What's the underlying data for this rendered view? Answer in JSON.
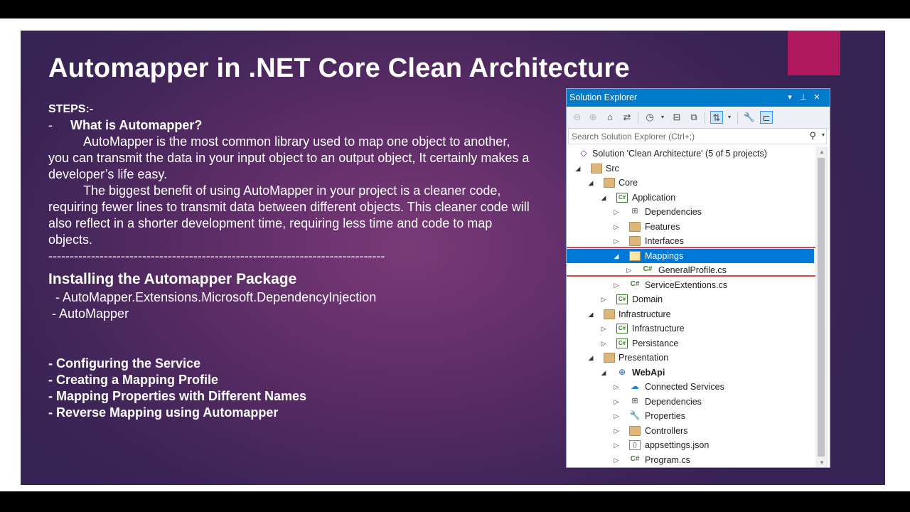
{
  "slide": {
    "title": "Automapper in .NET Core Clean Architecture",
    "steps_label": "STEPS:-",
    "bullet_dash": "-",
    "q_heading": "What is Automapper?",
    "para1": "AutoMapper is the most common library used to map one object to another, you can transmit the data in your input object to an output object, It certainly makes a developer’s life easy.",
    "para2": "The biggest benefit of using  AutoMapper in your project is a cleaner code, requiring fewer lines to transmit data between different objects. This cleaner code will also reflect in a shorter development time, requiring less time and code to map objects.",
    "divider": "-------------------------------------------------------------------------------",
    "install_heading": "Installing the Automapper Package",
    "packages": [
      "  - AutoMapper.Extensions.Microsoft.DependencyInjection",
      " - AutoMapper"
    ],
    "topics": [
      "- Configuring the Service",
      "- Creating a Mapping Profile",
      "- Mapping Properties with Different Names",
      "- Reverse Mapping using Automapper"
    ],
    "colors": {
      "accent": "#b0195e",
      "background": "#5b2c66",
      "text": "#ffffff"
    }
  },
  "solution_explorer": {
    "title": "Solution Explorer",
    "window_buttons": {
      "dropdown": "▾",
      "pin": "⊥",
      "close": "✕"
    },
    "toolbar_icons": [
      "back-icon",
      "forward-icon",
      "home-icon",
      "switch-views-icon",
      "history-icon",
      "collapse-all-icon",
      "show-all-files-icon",
      "sync-icon",
      "properties-wrench-icon",
      "preview-icon"
    ],
    "search_placeholder": "Search Solution Explorer (Ctrl+;)",
    "search_icon": "⚲",
    "search_dropdown": "▾",
    "tree": [
      {
        "label": "Solution 'Clean Architecture' (5 of 5 projects)",
        "icon": "sln",
        "glyph": "◇",
        "arrow": ""
      },
      {
        "label": "Src",
        "icon": "folder",
        "glyph": "",
        "arrow": "◢"
      },
      {
        "label": "Core",
        "icon": "folder",
        "glyph": "",
        "arrow": "◢"
      },
      {
        "label": "Application",
        "icon": "csproj",
        "glyph": "C#",
        "arrow": "◢"
      },
      {
        "label": "Dependencies",
        "icon": "dep",
        "glyph": "⊞",
        "arrow": "▷"
      },
      {
        "label": "Features",
        "icon": "folder",
        "glyph": "",
        "arrow": "▷"
      },
      {
        "label": "Interfaces",
        "icon": "folder",
        "glyph": "",
        "arrow": "▷"
      },
      {
        "label": "Mappings",
        "icon": "folder-open",
        "glyph": "",
        "arrow": "◢",
        "selected": true
      },
      {
        "label": "GeneralProfile.cs",
        "icon": "csfile",
        "glyph": "C#",
        "arrow": "▷"
      },
      {
        "label": "ServiceExtentions.cs",
        "icon": "csfile",
        "glyph": "C#",
        "arrow": "▷"
      },
      {
        "label": "Domain",
        "icon": "csproj",
        "glyph": "C#",
        "arrow": "▷"
      },
      {
        "label": "Infrastructure",
        "icon": "folder",
        "glyph": "",
        "arrow": "◢"
      },
      {
        "label": "Infrastructure",
        "icon": "csproj",
        "glyph": "C#",
        "arrow": "▷"
      },
      {
        "label": "Persistance",
        "icon": "csproj",
        "glyph": "C#",
        "arrow": "▷"
      },
      {
        "label": "Presentation",
        "icon": "folder",
        "glyph": "",
        "arrow": "◢"
      },
      {
        "label": "WebApi",
        "icon": "web",
        "glyph": "⊕",
        "arrow": "◢",
        "bold": true
      },
      {
        "label": "Connected Services",
        "icon": "conn",
        "glyph": "☁",
        "arrow": "▷"
      },
      {
        "label": "Dependencies",
        "icon": "dep",
        "glyph": "⊞",
        "arrow": "▷"
      },
      {
        "label": "Properties",
        "icon": "wrench",
        "glyph": "🔧",
        "arrow": "▷"
      },
      {
        "label": "Controllers",
        "icon": "folder",
        "glyph": "",
        "arrow": "▷"
      },
      {
        "label": "appsettings.json",
        "icon": "json",
        "glyph": "{}",
        "arrow": "▷"
      },
      {
        "label": "Program.cs",
        "icon": "csfile",
        "glyph": "C#",
        "arrow": "▷"
      }
    ]
  }
}
